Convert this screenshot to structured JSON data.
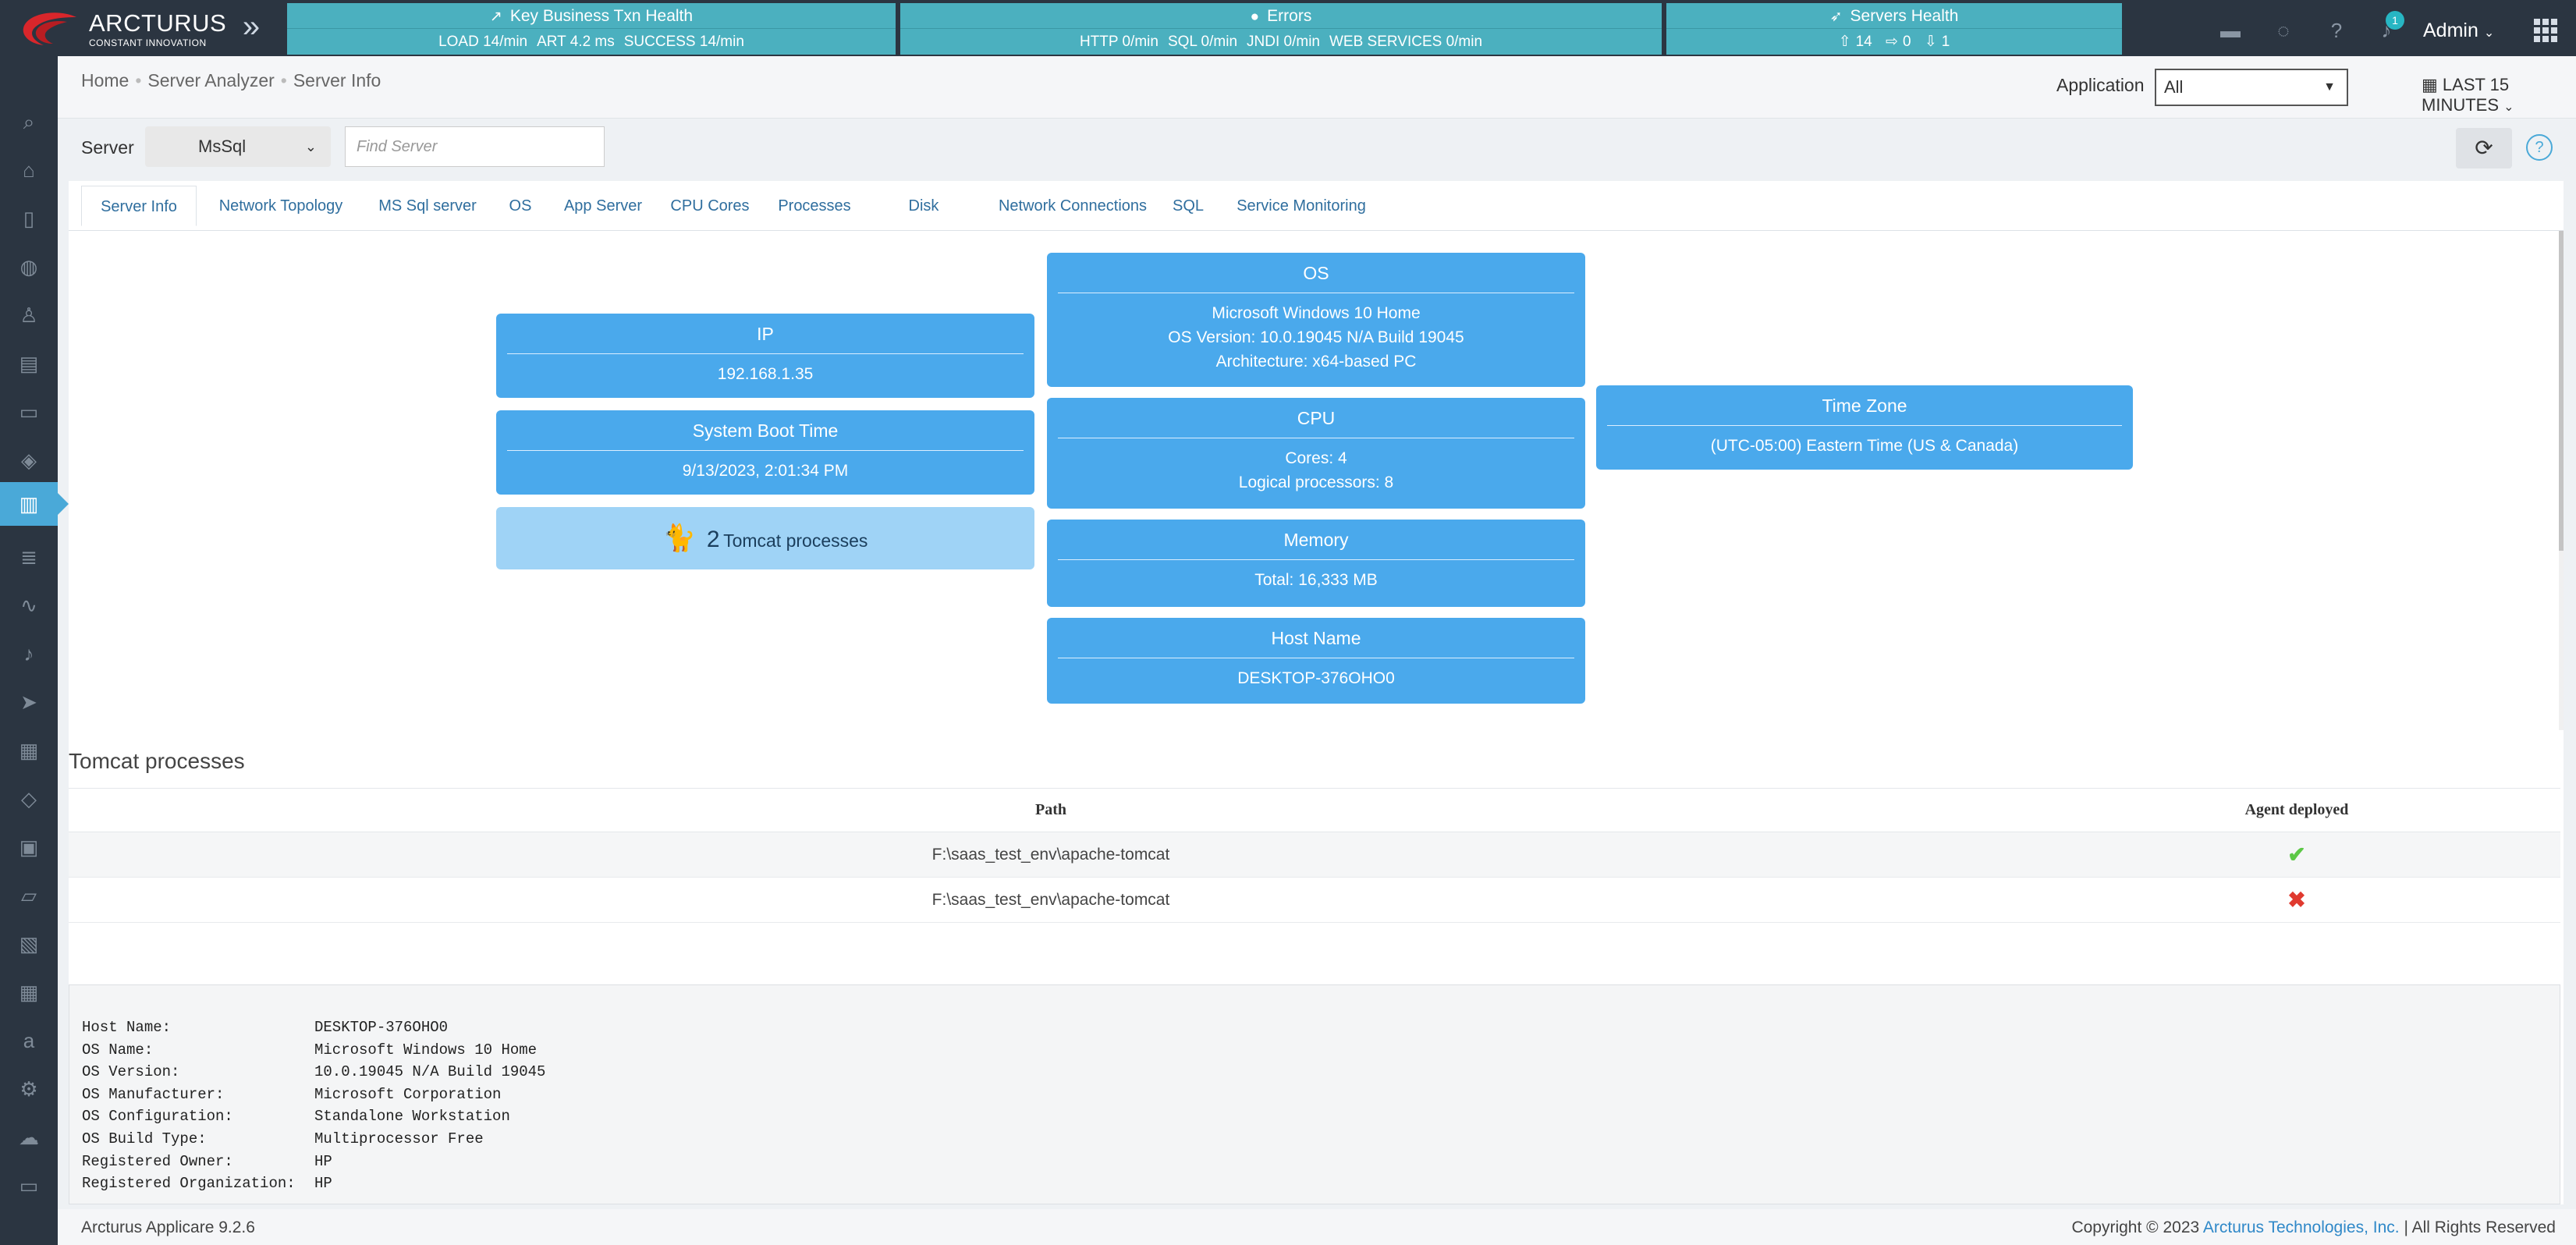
{
  "brand": {
    "name": "ARCTURUS",
    "tagline": "CONSTANT INNOVATION"
  },
  "health": {
    "business": {
      "title": "Key Business Txn Health",
      "load": "LOAD 14/min",
      "art": "ART 4.2 ms",
      "success": "SUCCESS 14/min"
    },
    "errors": {
      "title": "Errors",
      "http": "HTTP 0/min",
      "sql": "SQL 0/min",
      "jndi": "JNDI 0/min",
      "ws": "WEB SERVICES 0/min"
    },
    "servers": {
      "title": "Servers Health",
      "up": "14",
      "neutral": "0",
      "down": "1"
    }
  },
  "header_icons": {
    "notifications_count": "1"
  },
  "user": {
    "name": "Admin"
  },
  "breadcrumb": [
    "Home",
    "Server Analyzer",
    "Server Info"
  ],
  "application": {
    "label": "Application",
    "value": "All"
  },
  "time_range": "LAST 15 MINUTES",
  "server": {
    "label": "Server",
    "value": "MsSql",
    "search_placeholder": "Find Server"
  },
  "tabs": [
    "Server Info",
    "Network Topology",
    "MS Sql server",
    "OS",
    "App Server",
    "CPU Cores",
    "Processes",
    "Disk",
    "Network Connections",
    "SQL",
    "Service Monitoring"
  ],
  "cards": {
    "ip": {
      "title": "IP",
      "value": "192.168.1.35"
    },
    "boot": {
      "title": "System Boot Time",
      "value": "9/13/2023, 2:01:34 PM"
    },
    "tomcat": {
      "count": "2",
      "label": "Tomcat processes"
    },
    "os": {
      "title": "OS",
      "line1": "Microsoft Windows 10 Home",
      "line2": "OS Version: 10.0.19045 N/A Build 19045",
      "line3": "Architecture: x64-based PC"
    },
    "cpu": {
      "title": "CPU",
      "line1": "Cores: 4",
      "line2": "Logical processors: 8"
    },
    "memory": {
      "title": "Memory",
      "value": "Total: 16,333 MB"
    },
    "host": {
      "title": "Host Name",
      "value": "DESKTOP-376OHO0"
    },
    "timezone": {
      "title": "Time Zone",
      "value": "(UTC-05:00) Eastern Time (US & Canada)"
    }
  },
  "tomcat_section": {
    "title": "Tomcat processes",
    "columns": [
      "Path",
      "Agent deployed"
    ],
    "rows": [
      {
        "path": "F:\\saas_test_env\\apache-tomcat",
        "deployed": true
      },
      {
        "path": "F:\\saas_test_env\\apache-tomcat",
        "deployed": false
      }
    ]
  },
  "sysinfo": [
    {
      "k": "Host Name:",
      "v": "DESKTOP-376OHO0"
    },
    {
      "k": "OS Name:",
      "v": "Microsoft Windows 10 Home"
    },
    {
      "k": "OS Version:",
      "v": "10.0.19045 N/A Build 19045"
    },
    {
      "k": "OS Manufacturer:",
      "v": "Microsoft Corporation"
    },
    {
      "k": "OS Configuration:",
      "v": "Standalone Workstation"
    },
    {
      "k": "OS Build Type:",
      "v": "Multiprocessor Free"
    },
    {
      "k": "Registered Owner:",
      "v": "HP"
    },
    {
      "k": "Registered Organization:",
      "v": "HP"
    }
  ],
  "footer": {
    "version": "Arcturus Applicare 9.2.6",
    "copyright": "Copyright © 2023",
    "company": "Arcturus Technologies, Inc.",
    "rights": "|  All Rights Reserved"
  }
}
